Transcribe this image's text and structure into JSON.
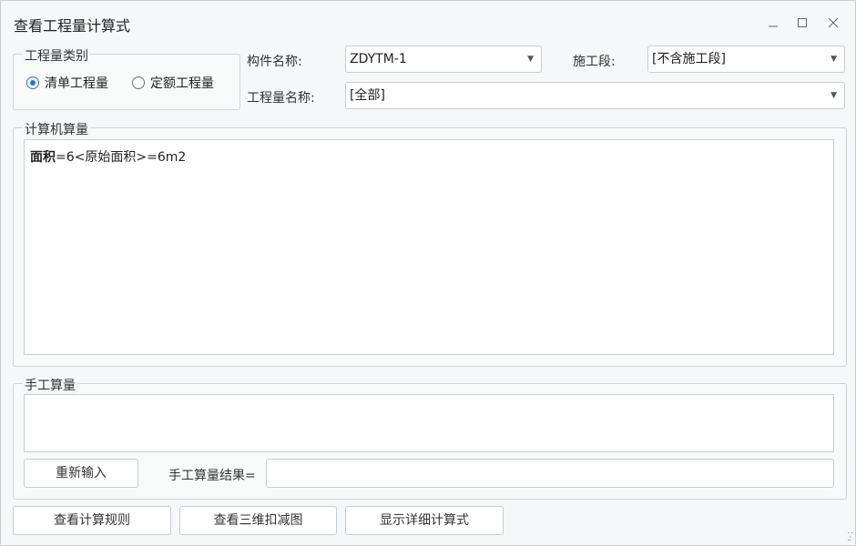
{
  "window": {
    "title": "查看工程量计算式",
    "minimize_icon": "minimize-icon",
    "maximize_icon": "maximize-icon",
    "close_icon": "close-icon"
  },
  "category": {
    "legend": "工程量类别",
    "options": [
      {
        "label": "清单工程量",
        "checked": true
      },
      {
        "label": "定额工程量",
        "checked": false
      }
    ]
  },
  "fields": {
    "component_label": "构件名称:",
    "component_value": "ZDYTM-1",
    "section_label": "施工段:",
    "section_value": "[不含施工段]",
    "quantity_label": "工程量名称:",
    "quantity_value": "[全部]"
  },
  "computer_calc": {
    "legend": "计算机算量",
    "formula_term": "面积",
    "formula_rest": "=6<原始面积>=6m2"
  },
  "manual_calc": {
    "legend": "手工算量",
    "reinput_label": "重新输入",
    "result_label": "手工算量结果=",
    "result_value": ""
  },
  "footer": {
    "rules_label": "查看计算规则",
    "view3d_label": "查看三维扣减图",
    "detail_label": "显示详细计算式"
  },
  "colors": {
    "accent": "#1e73d8",
    "border": "#c8ccd2"
  }
}
